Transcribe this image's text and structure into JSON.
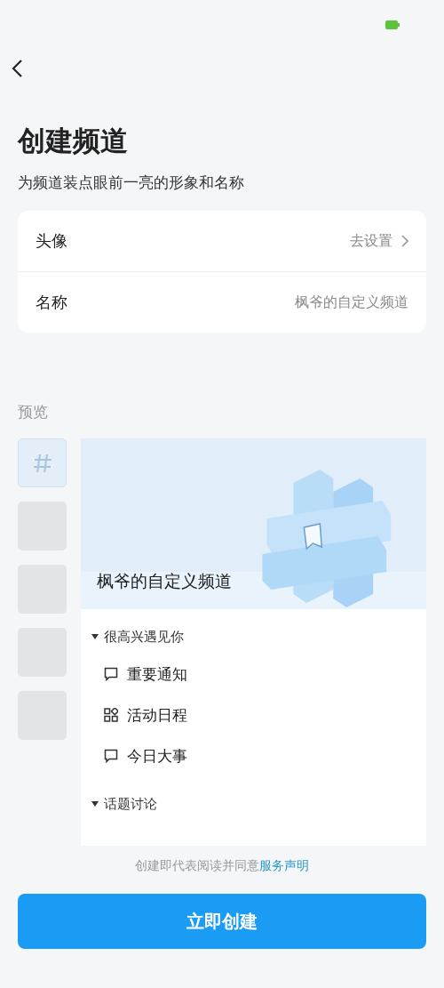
{
  "header": {
    "title": "创建频道",
    "subtitle": "为频道装点眼前一亮的形象和名称"
  },
  "settings": [
    {
      "label": "头像",
      "value": "去设置",
      "kind": "link"
    },
    {
      "label": "名称",
      "value": "枫爷的自定义频道",
      "kind": "text"
    }
  ],
  "preview": {
    "label": "预览",
    "banner_title": "枫爷的自定义频道",
    "thumbnails": [
      {
        "kind": "channel",
        "selected": true
      },
      {
        "kind": "blank",
        "selected": false
      },
      {
        "kind": "blank",
        "selected": false
      },
      {
        "kind": "blank",
        "selected": false
      },
      {
        "kind": "blank",
        "selected": false
      }
    ],
    "categories": [
      {
        "name": "很高兴遇见你",
        "expanded": true,
        "children": [
          {
            "name": "重要通知",
            "kind": "chat"
          },
          {
            "name": "活动日程",
            "kind": "grid"
          },
          {
            "name": "今日大事",
            "kind": "chat"
          }
        ]
      },
      {
        "name": "话题讨论",
        "expanded": true
      }
    ]
  },
  "agreement": {
    "text": "创建即代表阅读并同意",
    "link": "服务声明"
  },
  "create_button": "立即创建"
}
